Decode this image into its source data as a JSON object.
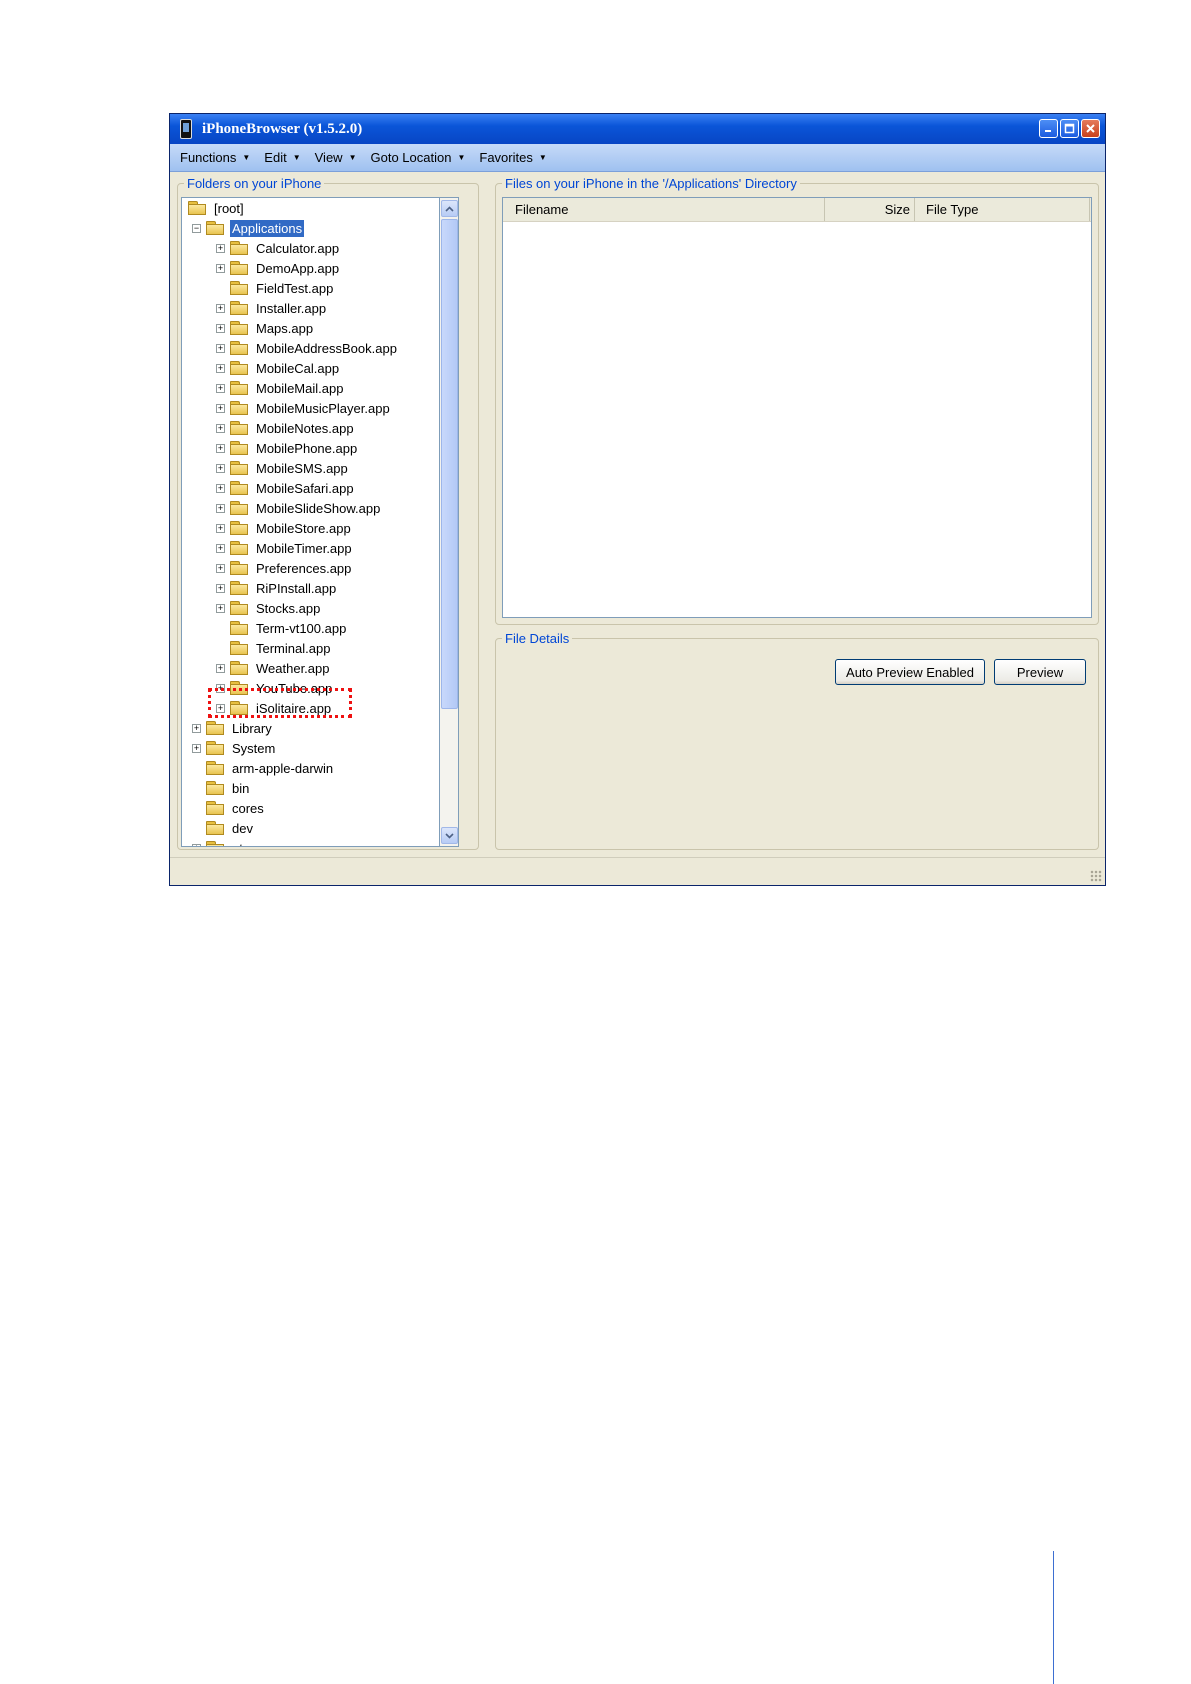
{
  "window": {
    "title": "iPhoneBrowser (v1.5.2.0)"
  },
  "menu": [
    {
      "label": "Functions"
    },
    {
      "label": "Edit"
    },
    {
      "label": "View"
    },
    {
      "label": "Goto Location"
    },
    {
      "label": "Favorites"
    }
  ],
  "folders_panel": {
    "legend": "Folders on your iPhone",
    "tree": [
      {
        "label": "[root]",
        "level": 0,
        "expander": "none",
        "open": false
      },
      {
        "label": "Applications",
        "level": 1,
        "expander": "minus",
        "open": true,
        "selected": true
      },
      {
        "label": "Calculator.app",
        "level": 2,
        "expander": "plus"
      },
      {
        "label": "DemoApp.app",
        "level": 2,
        "expander": "plus"
      },
      {
        "label": "FieldTest.app",
        "level": 2,
        "expander": "none"
      },
      {
        "label": "Installer.app",
        "level": 2,
        "expander": "plus"
      },
      {
        "label": "Maps.app",
        "level": 2,
        "expander": "plus"
      },
      {
        "label": "MobileAddressBook.app",
        "level": 2,
        "expander": "plus"
      },
      {
        "label": "MobileCal.app",
        "level": 2,
        "expander": "plus"
      },
      {
        "label": "MobileMail.app",
        "level": 2,
        "expander": "plus"
      },
      {
        "label": "MobileMusicPlayer.app",
        "level": 2,
        "expander": "plus"
      },
      {
        "label": "MobileNotes.app",
        "level": 2,
        "expander": "plus"
      },
      {
        "label": "MobilePhone.app",
        "level": 2,
        "expander": "plus"
      },
      {
        "label": "MobileSMS.app",
        "level": 2,
        "expander": "plus"
      },
      {
        "label": "MobileSafari.app",
        "level": 2,
        "expander": "plus"
      },
      {
        "label": "MobileSlideShow.app",
        "level": 2,
        "expander": "plus"
      },
      {
        "label": "MobileStore.app",
        "level": 2,
        "expander": "plus"
      },
      {
        "label": "MobileTimer.app",
        "level": 2,
        "expander": "plus"
      },
      {
        "label": "Preferences.app",
        "level": 2,
        "expander": "plus"
      },
      {
        "label": "RiPInstall.app",
        "level": 2,
        "expander": "plus"
      },
      {
        "label": "Stocks.app",
        "level": 2,
        "expander": "plus"
      },
      {
        "label": "Term-vt100.app",
        "level": 2,
        "expander": "none"
      },
      {
        "label": "Terminal.app",
        "level": 2,
        "expander": "none"
      },
      {
        "label": "Weather.app",
        "level": 2,
        "expander": "plus"
      },
      {
        "label": "YouTube.app",
        "level": 2,
        "expander": "plus"
      },
      {
        "label": "iSolitaire.app",
        "level": 2,
        "expander": "plus",
        "highlighted": true
      },
      {
        "label": "Library",
        "level": 1,
        "expander": "plus"
      },
      {
        "label": "System",
        "level": 1,
        "expander": "plus"
      },
      {
        "label": "arm-apple-darwin",
        "level": 1,
        "expander": "none"
      },
      {
        "label": "bin",
        "level": 1,
        "expander": "none"
      },
      {
        "label": "cores",
        "level": 1,
        "expander": "none"
      },
      {
        "label": "dev",
        "level": 1,
        "expander": "none"
      },
      {
        "label": "etc",
        "level": 1,
        "expander": "plus"
      }
    ]
  },
  "files_panel": {
    "legend": "Files on your iPhone in the '/Applications' Directory",
    "columns": {
      "filename": "Filename",
      "size": "Size",
      "type": "File Type"
    }
  },
  "details_panel": {
    "legend": "File Details",
    "auto_preview_label": "Auto Preview Enabled",
    "preview_label": "Preview"
  },
  "colors": {
    "titlebar": "#0a55d8",
    "legend_text": "#0046d5",
    "selection": "#316ac5",
    "highlight_box": "#ee1111"
  }
}
